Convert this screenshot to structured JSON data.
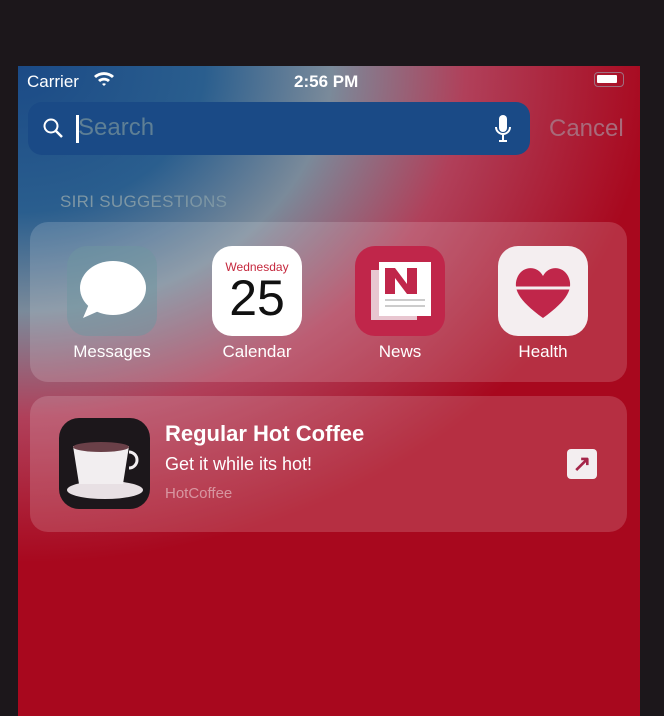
{
  "status": {
    "carrier": "Carrier",
    "time": "2:56 PM"
  },
  "search": {
    "placeholder": "Search",
    "cancel": "Cancel"
  },
  "siri": {
    "header": "SIRI SUGGESTIONS",
    "apps": [
      {
        "label": "Messages"
      },
      {
        "label": "Calendar",
        "weekday": "Wednesday",
        "day": "25"
      },
      {
        "label": "News"
      },
      {
        "label": "Health"
      }
    ]
  },
  "shortcut": {
    "title": "Regular Hot Coffee",
    "subtitle": "Get it while its hot!",
    "app": "HotCoffee"
  }
}
